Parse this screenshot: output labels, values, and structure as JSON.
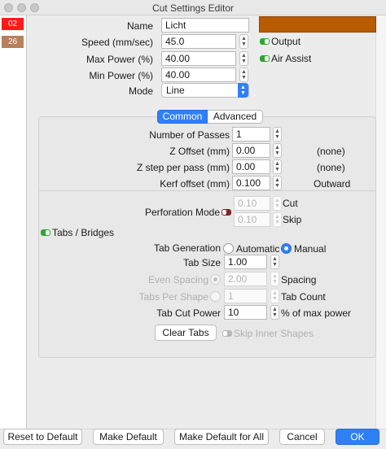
{
  "window": {
    "title": "Cut Settings Editor"
  },
  "layers": [
    {
      "label": "02",
      "color": "#ff1a1a"
    },
    {
      "label": "26",
      "color": "#b8805a"
    }
  ],
  "layer_color": "#b85c00",
  "fields": {
    "name": {
      "label": "Name",
      "value": "Licht"
    },
    "speed": {
      "label": "Speed (mm/sec)",
      "value": "45.0"
    },
    "max_power": {
      "label": "Max Power (%)",
      "value": "40.00"
    },
    "min_power": {
      "label": "Min Power (%)",
      "value": "40.00"
    },
    "mode": {
      "label": "Mode",
      "value": "Line"
    }
  },
  "toggles": {
    "output": {
      "label": "Output",
      "on": true
    },
    "air_assist": {
      "label": "Air Assist",
      "on": true
    }
  },
  "tabs": [
    {
      "label": "Common",
      "selected": true
    },
    {
      "label": "Advanced",
      "selected": false
    }
  ],
  "common": {
    "passes": {
      "label": "Number of Passes",
      "value": "1"
    },
    "z_offset": {
      "label": "Z Offset (mm)",
      "value": "0.00",
      "note": "(none)"
    },
    "z_step": {
      "label": "Z step per pass (mm)",
      "value": "0.00",
      "note": "(none)"
    },
    "kerf": {
      "label": "Kerf offset (mm)",
      "value": "0.100",
      "note": "Outward"
    },
    "perforation": {
      "label": "Perforation Mode",
      "cut_value": "0.10",
      "cut_label": "Cut",
      "skip_value": "0.10",
      "skip_label": "Skip"
    },
    "tabs_bridges": {
      "label": "Tabs / Bridges"
    },
    "tab_generation": {
      "label": "Tab Generation",
      "automatic": "Automatic",
      "manual": "Manual",
      "selected": "manual"
    },
    "tab_size": {
      "label": "Tab Size",
      "value": "1.00"
    },
    "even_spacing": {
      "label": "Even Spacing",
      "value": "2.00",
      "unit": "Spacing"
    },
    "tabs_per_shape": {
      "label": "Tabs Per Shape",
      "value": "1",
      "unit": "Tab Count"
    },
    "tab_cut_power": {
      "label": "Tab Cut Power",
      "value": "10",
      "unit": "% of max power"
    },
    "clear_tabs": "Clear Tabs",
    "skip_inner": "Skip Inner Shapes"
  },
  "buttons": {
    "reset": "Reset to Default",
    "make_default": "Make Default",
    "make_default_all": "Make Default for All",
    "cancel": "Cancel",
    "ok": "OK"
  }
}
